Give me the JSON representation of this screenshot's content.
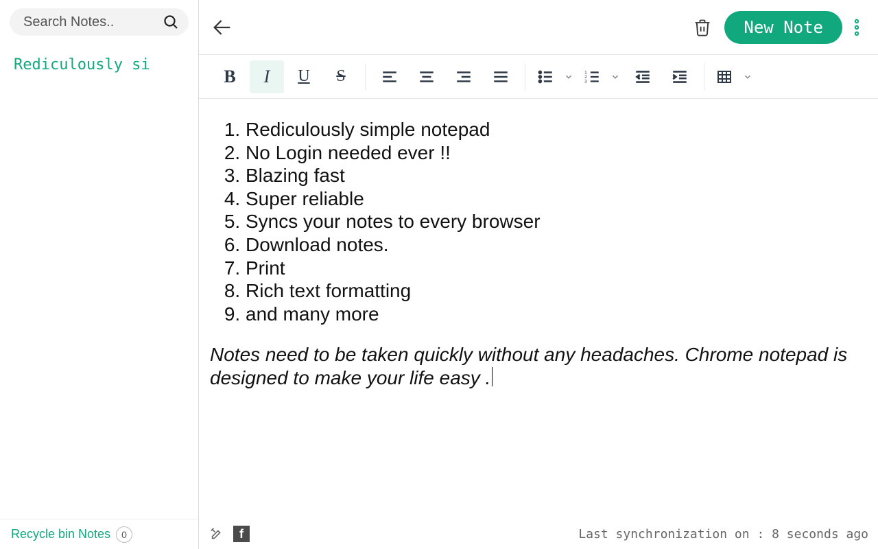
{
  "sidebar": {
    "search_placeholder": "Search Notes..",
    "notes": [
      {
        "title": "Rediculously si"
      }
    ],
    "recycle_label": "Recycle bin Notes",
    "recycle_count": "0"
  },
  "header": {
    "new_note_label": "New Note"
  },
  "editor": {
    "list_items": [
      "Rediculously simple notepad",
      "No Login needed ever !!",
      "Blazing fast",
      "Super reliable",
      "Syncs your notes to every browser",
      "Download notes.",
      "Print",
      "Rich text formatting",
      "and many more"
    ],
    "paragraph": "Notes need to be taken quickly without any headaches. Chrome notepad is designed to make your life easy ."
  },
  "status": {
    "sync_text": "Last synchronization on : 8 seconds ago"
  },
  "toolbar": {
    "active_format": "italic"
  },
  "colors": {
    "accent": "#12a87e"
  }
}
